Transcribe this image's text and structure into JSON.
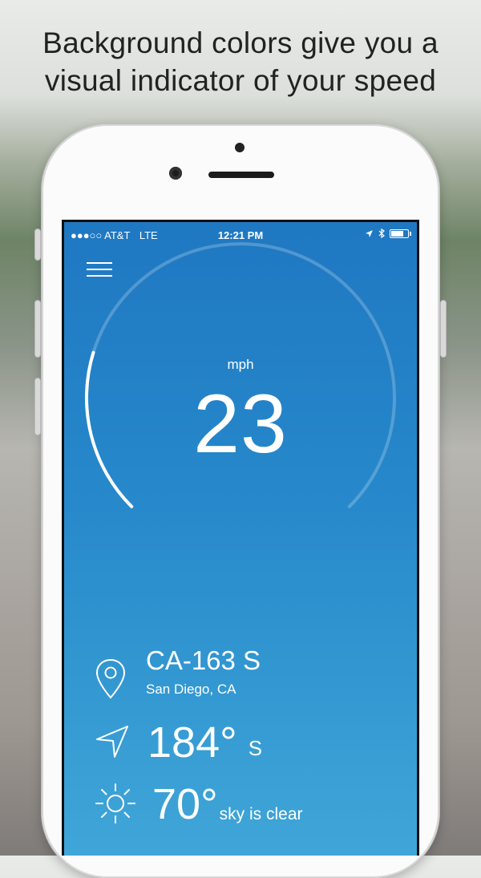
{
  "headline": {
    "line1": "Background colors give you a",
    "line2": "visual indicator of your speed"
  },
  "status_bar": {
    "carrier": "●●●○○ AT&T",
    "network": "LTE",
    "time": "12:21 PM"
  },
  "speedometer": {
    "unit": "mph",
    "speed": "23",
    "speed_fraction": 0.23
  },
  "location": {
    "road": "CA-163 S",
    "city": "San Diego, CA"
  },
  "heading": {
    "degrees": "184°",
    "direction": "S"
  },
  "weather": {
    "temperature": "70°",
    "condition": "sky is clear"
  },
  "colors": {
    "screen_top": "#1f78c2",
    "screen_bottom": "#40a6d8",
    "foreground": "#ffffff"
  }
}
